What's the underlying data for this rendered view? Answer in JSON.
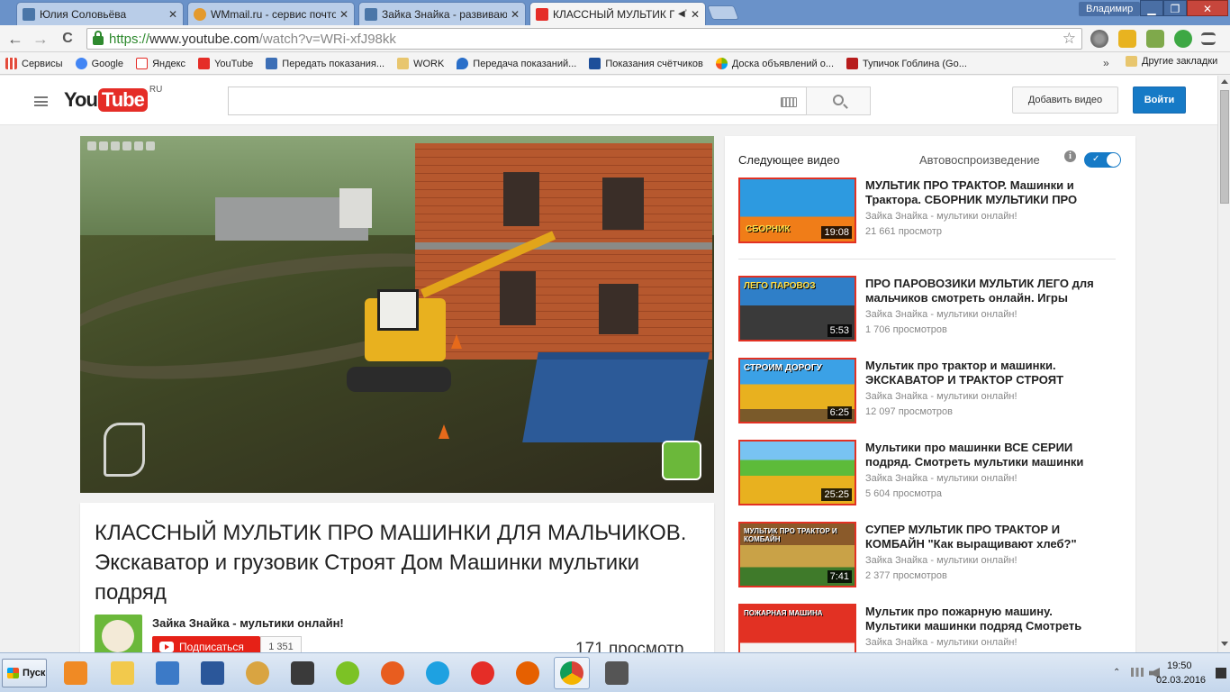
{
  "browser": {
    "tabs": [
      {
        "title": "Юлия Соловьёва",
        "favicon_color": "#4a76a8"
      },
      {
        "title": "WMmail.ru - сервис почтовы",
        "favicon_color": "#e39a2e"
      },
      {
        "title": "Зайка Знайка - развивающ",
        "favicon_color": "#4a76a8"
      },
      {
        "title": "КЛАССНЫЙ МУЛЬТИК ПР",
        "favicon_color": "#e52d27"
      }
    ],
    "user": "Владимир",
    "window_buttons": {
      "minimize": "▁",
      "maximize": "❐",
      "close": "✕"
    },
    "tab_close": "✕",
    "url": {
      "scheme": "https://",
      "host": "www.youtube.com",
      "path": "/watch?v=WRi-xfJ98kk"
    },
    "nav": {
      "back": "←",
      "forward": "→",
      "reload": "C",
      "star": "☆"
    },
    "bookmarks": [
      {
        "label": "Сервисы",
        "icon": "apps-grid-icon",
        "color": "#e34b3b"
      },
      {
        "label": "Google",
        "icon": "google-icon",
        "color": "#4285f4"
      },
      {
        "label": "Яндекс",
        "icon": "yandex-icon",
        "color": "#e52d27"
      },
      {
        "label": "YouTube",
        "icon": "youtube-icon",
        "color": "#e52d27"
      },
      {
        "label": "Передать показания...",
        "icon": "pen-icon",
        "color": "#3d6fb6"
      },
      {
        "label": "WORK",
        "icon": "folder-icon",
        "color": "#e8c66e"
      },
      {
        "label": "Передача показаний...",
        "icon": "drop-icon",
        "color": "#2a6fc9"
      },
      {
        "label": "Показания счётчиков",
        "icon": "water-icon",
        "color": "#1d4f9a"
      },
      {
        "label": "Доска объявлений о...",
        "icon": "avito-icon",
        "color": "#7fba00"
      },
      {
        "label": "Тупичок Гоблина (Go...",
        "icon": "goblin-icon",
        "color": "#b71c1c"
      }
    ],
    "bookmarks_more": "»",
    "other_bookmarks": "Другие закладки"
  },
  "youtube": {
    "logo_you": "You",
    "logo_tube": "Tube",
    "logo_region": "RU",
    "search_placeholder": "",
    "upload_label": "Добавить видео",
    "signin_label": "Войти",
    "video": {
      "title": "КЛАССНЫЙ МУЛЬТИК ПРО МАШИНКИ ДЛЯ МАЛЬЧИКОВ. Экскаватор и грузовик Строят Дом Машинки мультики подряд",
      "channel": "Зайка Знайка - мультики онлайн!",
      "subscribe_label": "Подписаться",
      "subscriber_count": "1 351",
      "views": "171 просмотр"
    },
    "sidebar": {
      "up_next": "Следующее видео",
      "autoplay": "Автовоспроизведение",
      "autoplay_on": true,
      "info_glyph": "i",
      "check_glyph": "✓",
      "items": [
        {
          "title": "МУЛЬТИК ПРО ТРАКТОР. Машинки и Трактора. СБОРНИК МУЛЬТИКИ ПРО",
          "channel": "Зайка Знайка - мультики онлайн!",
          "views": "21 661 просмотр",
          "duration": "19:08",
          "thumb_caption": "СБОРНИК",
          "thumb_color": "#2d9ae0"
        },
        {
          "title": "ПРО ПАРОВОЗИКИ МУЛЬТИК ЛЕГО для мальчиков смотреть онлайн. Игры",
          "channel": "Зайка Знайка - мультики онлайн!",
          "views": "1 706 просмотров",
          "duration": "5:53",
          "thumb_caption": "ЛЕГО ПАРОВОЗ",
          "thumb_color": "#2f7fc8"
        },
        {
          "title": "Мультик про трактор и машинки. ЭКСКАВАТОР И ТРАКТОР СТРОЯТ",
          "channel": "Зайка Знайка - мультики онлайн!",
          "views": "12 097 просмотров",
          "duration": "6:25",
          "thumb_caption": "СТРОИМ ДОРОГУ",
          "thumb_color": "#3ba1e6"
        },
        {
          "title": "Мультики про машинки ВСЕ СЕРИИ подряд. Смотреть мультики машинки",
          "channel": "Зайка Знайка - мультики онлайн!",
          "views": "5 604 просмотра",
          "duration": "25:25",
          "thumb_caption": "",
          "thumb_color": "#5dbb3a"
        },
        {
          "title": "СУПЕР МУЛЬТИК ПРО ТРАКТОР И КОМБАЙН \"Как выращивают хлеб?\"",
          "channel": "Зайка Знайка - мультики онлайн!",
          "views": "2 377 просмотров",
          "duration": "7:41",
          "thumb_caption": "МУЛЬТИК ПРО ТРАКТОР И КОМБАЙН",
          "thumb_color": "#8a5a2a"
        },
        {
          "title": "Мультик про пожарную машину. Мультики машинки подряд Смотреть",
          "channel": "Зайка Знайка - мультики онлайн!",
          "views": "",
          "duration": "",
          "thumb_caption": "ПОЖАРНАЯ МАШИНА",
          "thumb_color": "#e23123"
        }
      ]
    }
  },
  "taskbar": {
    "start_label": "Пуск",
    "apps": [
      {
        "icon": "media-player-icon",
        "color": "#f08a24"
      },
      {
        "icon": "explorer-icon",
        "color": "#f2c94c"
      },
      {
        "icon": "my-computer-icon",
        "color": "#3c7ac7"
      },
      {
        "icon": "word-icon",
        "color": "#2b579a"
      },
      {
        "icon": "paint-icon",
        "color": "#d9a441"
      },
      {
        "icon": "world-of-tanks-icon",
        "color": "#3a3a3a"
      },
      {
        "icon": "plus-game-icon",
        "color": "#7cc225"
      },
      {
        "icon": "game-center-icon",
        "color": "#e85d1f"
      },
      {
        "icon": "internet-explorer-icon",
        "color": "#1ea1e1"
      },
      {
        "icon": "yandex-browser-icon",
        "color": "#e52d27"
      },
      {
        "icon": "firefox-icon",
        "color": "#e66000"
      },
      {
        "icon": "chrome-icon",
        "color": "#4285f4"
      },
      {
        "icon": "helmet-icon",
        "color": "#555555"
      }
    ],
    "tray_arrow": "⌃",
    "clock_time": "19:50",
    "clock_date": "02.03.2016"
  }
}
